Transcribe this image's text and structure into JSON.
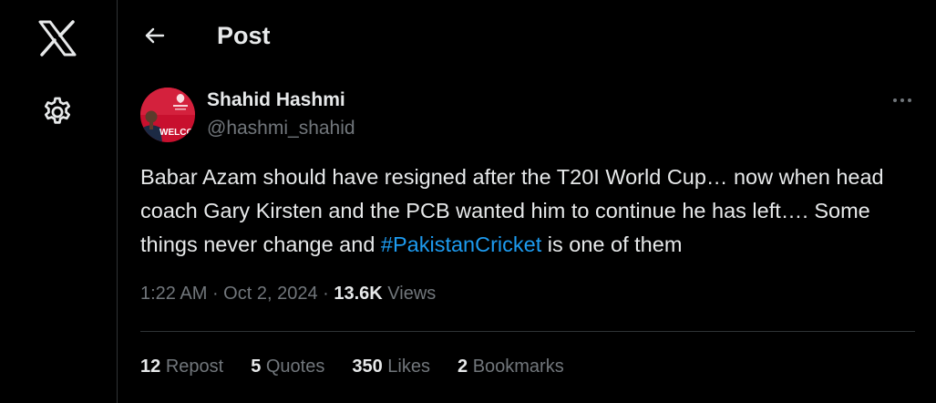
{
  "nav": {
    "logo_icon": "x-logo-icon",
    "settings_icon": "gear-icon"
  },
  "header": {
    "back_icon": "arrow-left-icon",
    "title": "Post"
  },
  "post": {
    "author": {
      "name": "Shahid Hashmi",
      "handle": "@hashmi_shahid",
      "avatar_caption": "WELCO"
    },
    "text_part1": "Babar Azam should have resigned after the T20I World Cup… now when head coach Gary Kirsten and the PCB wanted him to continue he has left…. Some things never change and ",
    "hashtag": "#PakistanCricket",
    "text_part2": " is one of them",
    "time": "1:22 AM",
    "date": "Oct 2, 2024",
    "views_count": "13.6K",
    "views_label": "Views",
    "more_icon": "more-horizontal-icon",
    "stats": [
      {
        "count": "12",
        "label": "Repost"
      },
      {
        "count": "5",
        "label": "Quotes"
      },
      {
        "count": "350",
        "label": "Likes"
      },
      {
        "count": "2",
        "label": "Bookmarks"
      }
    ]
  },
  "colors": {
    "background": "#000000",
    "text_primary": "#e7e9ea",
    "text_secondary": "#71767b",
    "accent": "#1d9bf0",
    "border": "#2f3336"
  }
}
